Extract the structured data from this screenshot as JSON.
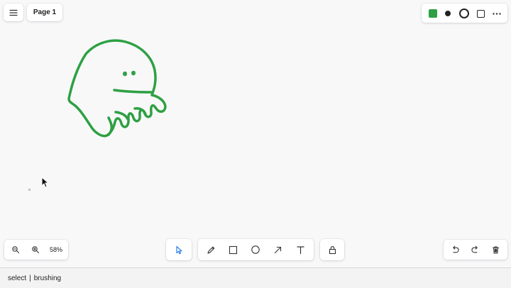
{
  "header": {
    "menu_icon": "menu-icon",
    "page_label": "Page 1"
  },
  "style_panel": {
    "active_color": "#2ea043",
    "items": [
      "color-swatch",
      "small-dot-size-icon",
      "ring-stroke-icon",
      "square-shape-icon",
      "more-icon"
    ]
  },
  "zoom": {
    "zoom_out_icon": "zoom-out-icon",
    "zoom_in_icon": "zoom-in-icon",
    "value": "58%"
  },
  "toolbar": {
    "tools": [
      {
        "name": "select-tool",
        "icon": "cursor-icon",
        "active": true
      },
      {
        "name": "draw-tool",
        "icon": "pencil-icon"
      },
      {
        "name": "rectangle-tool",
        "icon": "rectangle-icon"
      },
      {
        "name": "ellipse-tool",
        "icon": "circle-icon"
      },
      {
        "name": "arrow-tool",
        "icon": "arrow-icon"
      },
      {
        "name": "text-tool",
        "icon": "text-icon"
      },
      {
        "name": "lock-tool",
        "icon": "lock-icon"
      }
    ],
    "accent": "#2f80ed"
  },
  "history": {
    "undo_icon": "undo-icon",
    "redo_icon": "redo-icon",
    "delete_icon": "trash-icon"
  },
  "canvas": {
    "stroke_color": "#2ea043",
    "shape": "hand-drawn-ghost"
  },
  "status": {
    "tool": "select",
    "state": "brushing"
  }
}
